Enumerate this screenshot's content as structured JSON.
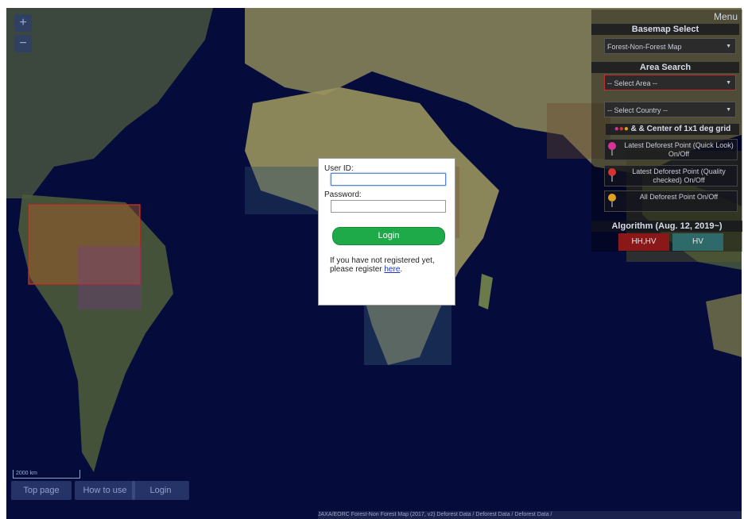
{
  "map": {
    "zoom_in": "+",
    "zoom_out": "−",
    "scale_label": "2000 km"
  },
  "nav": {
    "top_page": "Top page",
    "how_to_use": "How to use",
    "login": "Login"
  },
  "panel": {
    "menu": "Menu",
    "basemap_title": "Basemap Select",
    "basemap_value": "Forest-Non-Forest Map",
    "area_title": "Area Search",
    "area_placeholder": "-- Select Area --",
    "country_placeholder": "-- Select Country --",
    "grid_title": "& & Center of 1x1 deg grid",
    "toggle1": "Latest Deforest Point (Quick Look) On/Off",
    "toggle2": "Latest Deforest Point (Quality checked) On/Off",
    "toggle3": "All Deforest Point On/Off",
    "algorithm_title": "Algorithm (Aug. 12, 2019~)",
    "algo_hhhv": "HH,HV",
    "algo_hv": "HV"
  },
  "login_dialog": {
    "user_id_label": "User ID:",
    "password_label": "Password:",
    "login_button": "Login",
    "register_text": "If you have not registered yet, please register ",
    "register_link": "here",
    "register_end": "."
  },
  "statusbar": {
    "text": "JAXA/EORC Forest-Non Forest Map (2017, v2) Deforest Data / Deforest Data / Deforest Data /"
  },
  "colors": {
    "ocean": "#050b3a",
    "login_green": "#1faa4a",
    "pin_quick": "#d8329a",
    "pin_quality": "#d83232",
    "pin_all": "#e0a020"
  }
}
